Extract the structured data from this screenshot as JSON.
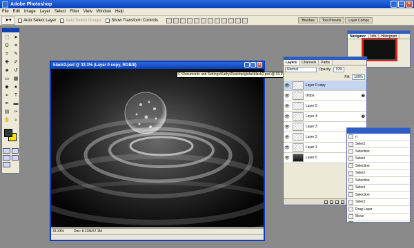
{
  "app": {
    "title": "Adobe Photoshop"
  },
  "menu": [
    "File",
    "Edit",
    "Image",
    "Layer",
    "Select",
    "Filter",
    "View",
    "Window",
    "Help"
  ],
  "options": {
    "auto_select_layer": "Auto Select Layer",
    "auto_select_groups": "Auto Select Groups",
    "show_transform": "Show Transform Controls",
    "well_tabs": [
      "Brushes",
      "Tool Presets",
      "Layer Comps"
    ]
  },
  "document": {
    "title": "black2.psd @ 33.3% (Layer 0 copy, RGB/8)",
    "zoom": "33.33%",
    "doc_size": "Doc: 8.22M/37.1M",
    "path_tooltip": "C:\\Documents and Settings\\Kathy\\Desktop\\globe\\black2.psd @ 33.3% (Layer 0 copy, RGB/8)"
  },
  "navigator": {
    "tabs": [
      "Navigator",
      "Info",
      "Histogram"
    ]
  },
  "layers": {
    "tabs": [
      "Layers",
      "Channels",
      "Paths"
    ],
    "blend_mode": "Normal",
    "opacity_label": "Opacity:",
    "opacity": "19%",
    "fill_label": "Fill:",
    "fill": "100%",
    "items": [
      {
        "name": "Layer 0 copy",
        "selected": true,
        "fx": false
      },
      {
        "name": "drops",
        "selected": false,
        "fx": true
      },
      {
        "name": "Layer 5",
        "selected": false,
        "fx": false
      },
      {
        "name": "Layer 4",
        "selected": false,
        "fx": true
      },
      {
        "name": "Layer 3",
        "selected": false,
        "fx": false
      },
      {
        "name": "Layer 2",
        "selected": false,
        "fx": false
      },
      {
        "name": "Layer 1",
        "selected": false,
        "fx": true
      },
      {
        "name": "Layer 0",
        "selected": false,
        "fx": false
      }
    ]
  },
  "history": {
    "items": [
      "n",
      "Select",
      "Selection",
      "Select",
      "Selection",
      "Select",
      "Selection",
      "Select",
      "Selection",
      "Select",
      "Drag Layer",
      "Move",
      "Drag Layer",
      "Move"
    ]
  },
  "colors": {
    "foreground": "#2d3a3a",
    "background": "#f5e400",
    "titlebar": "#0a3fb8"
  }
}
